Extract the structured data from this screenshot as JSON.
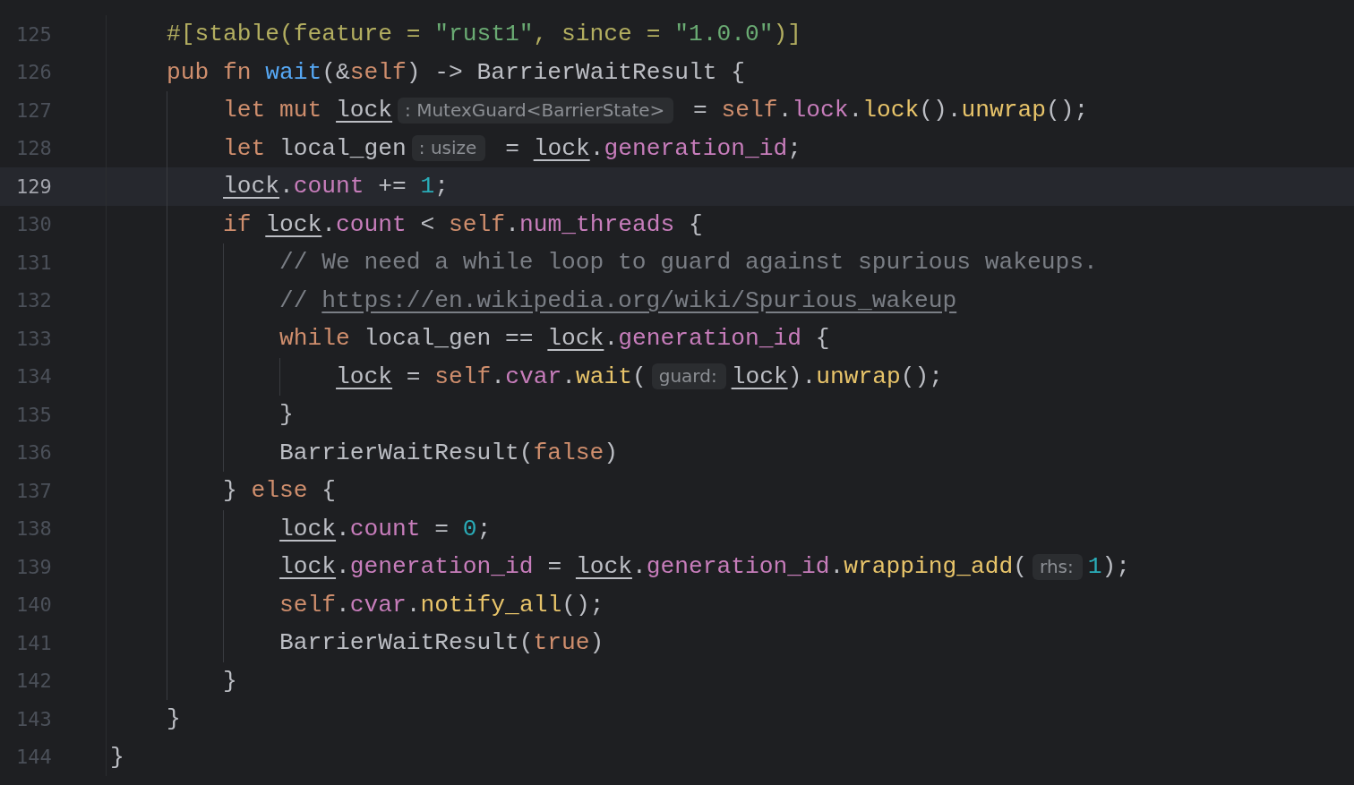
{
  "editor": {
    "lines": [
      {
        "number": "125",
        "current": false,
        "tokens": [
          {
            "kind": "attribute",
            "text": "    #[stable(feature = "
          },
          {
            "kind": "string",
            "text": "\"rust1\""
          },
          {
            "kind": "attribute",
            "text": ", since = "
          },
          {
            "kind": "string",
            "text": "\"1.0.0\""
          },
          {
            "kind": "attribute",
            "text": ")]"
          }
        ]
      },
      {
        "number": "126",
        "current": false,
        "tokens": [
          {
            "kind": "keyword",
            "text": "    pub fn "
          },
          {
            "kind": "function",
            "text": "wait"
          },
          {
            "kind": "plain",
            "text": "(&"
          },
          {
            "kind": "keyword",
            "text": "self"
          },
          {
            "kind": "plain",
            "text": ") -> BarrierWaitResult {"
          }
        ]
      },
      {
        "number": "127",
        "current": false,
        "tokens": [
          {
            "kind": "keyword",
            "text": "        let mut "
          },
          {
            "kind": "variable",
            "text": "lock"
          },
          {
            "kind": "hint",
            "text": ": MutexGuard<BarrierState>"
          },
          {
            "kind": "plain",
            "text": " = "
          },
          {
            "kind": "keyword",
            "text": "self"
          },
          {
            "kind": "plain",
            "text": "."
          },
          {
            "kind": "field",
            "text": "lock"
          },
          {
            "kind": "plain",
            "text": "."
          },
          {
            "kind": "method",
            "text": "lock"
          },
          {
            "kind": "plain",
            "text": "()."
          },
          {
            "kind": "method",
            "text": "unwrap"
          },
          {
            "kind": "plain",
            "text": "();"
          }
        ]
      },
      {
        "number": "128",
        "current": false,
        "tokens": [
          {
            "kind": "keyword",
            "text": "        let "
          },
          {
            "kind": "plain",
            "text": "local_gen"
          },
          {
            "kind": "hint",
            "text": ": usize"
          },
          {
            "kind": "plain",
            "text": " = "
          },
          {
            "kind": "variable",
            "text": "lock"
          },
          {
            "kind": "plain",
            "text": "."
          },
          {
            "kind": "field",
            "text": "generation_id"
          },
          {
            "kind": "plain",
            "text": ";"
          }
        ]
      },
      {
        "number": "129",
        "current": true,
        "tokens": [
          {
            "kind": "variable",
            "text": "        lock"
          },
          {
            "kind": "plain",
            "text": "."
          },
          {
            "kind": "field",
            "text": "count"
          },
          {
            "kind": "plain",
            "text": " += "
          },
          {
            "kind": "number",
            "text": "1"
          },
          {
            "kind": "plain",
            "text": ";"
          }
        ]
      },
      {
        "number": "130",
        "current": false,
        "tokens": [
          {
            "kind": "keyword",
            "text": "        if "
          },
          {
            "kind": "variable",
            "text": "lock"
          },
          {
            "kind": "plain",
            "text": "."
          },
          {
            "kind": "field",
            "text": "count"
          },
          {
            "kind": "plain",
            "text": " < "
          },
          {
            "kind": "keyword",
            "text": "self"
          },
          {
            "kind": "plain",
            "text": "."
          },
          {
            "kind": "field",
            "text": "num_threads"
          },
          {
            "kind": "plain",
            "text": " {"
          }
        ]
      },
      {
        "number": "131",
        "current": false,
        "tokens": [
          {
            "kind": "comment",
            "text": "            // We need a while loop to guard against spurious wakeups."
          }
        ]
      },
      {
        "number": "132",
        "current": false,
        "tokens": [
          {
            "kind": "comment",
            "text": "            // "
          },
          {
            "kind": "link",
            "text": "https://en.wikipedia.org/wiki/Spurious_wakeup"
          }
        ]
      },
      {
        "number": "133",
        "current": false,
        "tokens": [
          {
            "kind": "keyword",
            "text": "            while "
          },
          {
            "kind": "plain",
            "text": "local_gen == "
          },
          {
            "kind": "variable",
            "text": "lock"
          },
          {
            "kind": "plain",
            "text": "."
          },
          {
            "kind": "field",
            "text": "generation_id"
          },
          {
            "kind": "plain",
            "text": " {"
          }
        ]
      },
      {
        "number": "134",
        "current": false,
        "tokens": [
          {
            "kind": "variable",
            "text": "                lock"
          },
          {
            "kind": "plain",
            "text": " = "
          },
          {
            "kind": "keyword",
            "text": "self"
          },
          {
            "kind": "plain",
            "text": "."
          },
          {
            "kind": "field",
            "text": "cvar"
          },
          {
            "kind": "plain",
            "text": "."
          },
          {
            "kind": "method",
            "text": "wait"
          },
          {
            "kind": "plain",
            "text": "("
          },
          {
            "kind": "hint",
            "text": "guard:"
          },
          {
            "kind": "variable",
            "text": "lock"
          },
          {
            "kind": "plain",
            "text": ")."
          },
          {
            "kind": "method",
            "text": "unwrap"
          },
          {
            "kind": "plain",
            "text": "();"
          }
        ]
      },
      {
        "number": "135",
        "current": false,
        "tokens": [
          {
            "kind": "plain",
            "text": "            }"
          }
        ]
      },
      {
        "number": "136",
        "current": false,
        "tokens": [
          {
            "kind": "plain",
            "text": "            BarrierWaitResult("
          },
          {
            "kind": "keyword",
            "text": "false"
          },
          {
            "kind": "plain",
            "text": ")"
          }
        ]
      },
      {
        "number": "137",
        "current": false,
        "tokens": [
          {
            "kind": "plain",
            "text": "        } "
          },
          {
            "kind": "keyword",
            "text": "else"
          },
          {
            "kind": "plain",
            "text": " {"
          }
        ]
      },
      {
        "number": "138",
        "current": false,
        "tokens": [
          {
            "kind": "variable",
            "text": "            lock"
          },
          {
            "kind": "plain",
            "text": "."
          },
          {
            "kind": "field",
            "text": "count"
          },
          {
            "kind": "plain",
            "text": " = "
          },
          {
            "kind": "number",
            "text": "0"
          },
          {
            "kind": "plain",
            "text": ";"
          }
        ]
      },
      {
        "number": "139",
        "current": false,
        "tokens": [
          {
            "kind": "variable",
            "text": "            lock"
          },
          {
            "kind": "plain",
            "text": "."
          },
          {
            "kind": "field",
            "text": "generation_id"
          },
          {
            "kind": "plain",
            "text": " = "
          },
          {
            "kind": "variable",
            "text": "lock"
          },
          {
            "kind": "plain",
            "text": "."
          },
          {
            "kind": "field",
            "text": "generation_id"
          },
          {
            "kind": "plain",
            "text": "."
          },
          {
            "kind": "method",
            "text": "wrapping_add"
          },
          {
            "kind": "plain",
            "text": "("
          },
          {
            "kind": "hint",
            "text": "rhs:"
          },
          {
            "kind": "number",
            "text": "1"
          },
          {
            "kind": "plain",
            "text": ");"
          }
        ]
      },
      {
        "number": "140",
        "current": false,
        "tokens": [
          {
            "kind": "keyword",
            "text": "            self"
          },
          {
            "kind": "plain",
            "text": "."
          },
          {
            "kind": "field",
            "text": "cvar"
          },
          {
            "kind": "plain",
            "text": "."
          },
          {
            "kind": "method",
            "text": "notify_all"
          },
          {
            "kind": "plain",
            "text": "();"
          }
        ]
      },
      {
        "number": "141",
        "current": false,
        "tokens": [
          {
            "kind": "plain",
            "text": "            BarrierWaitResult("
          },
          {
            "kind": "keyword",
            "text": "true"
          },
          {
            "kind": "plain",
            "text": ")"
          }
        ]
      },
      {
        "number": "142",
        "current": false,
        "tokens": [
          {
            "kind": "plain",
            "text": "        }"
          }
        ]
      },
      {
        "number": "143",
        "current": false,
        "tokens": [
          {
            "kind": "plain",
            "text": "    }"
          }
        ]
      },
      {
        "number": "144",
        "current": false,
        "tokens": [
          {
            "kind": "plain",
            "text": "}"
          }
        ]
      }
    ]
  }
}
